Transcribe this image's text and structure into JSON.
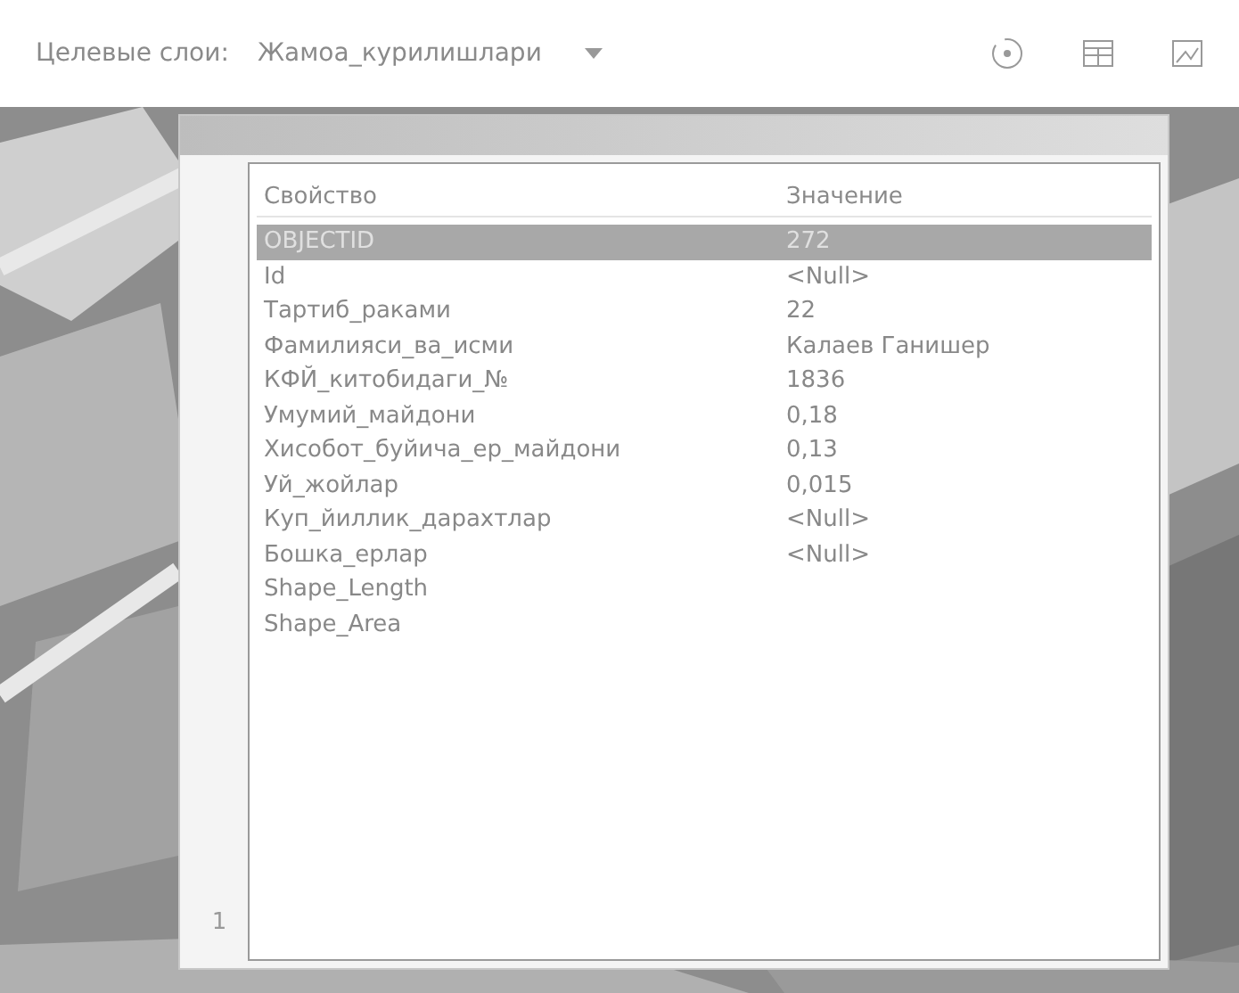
{
  "toolbar": {
    "label": "Целевые слои:",
    "layer": "Жамоа_курилишлари"
  },
  "attributes": {
    "columns": [
      "Свойство",
      "Значение"
    ],
    "rows": [
      {
        "property": "OBJECTID",
        "value": "272",
        "selected": true
      },
      {
        "property": "Id",
        "value": "<Null>",
        "selected": false
      },
      {
        "property": "Тартиб_раками",
        "value": "22",
        "selected": false
      },
      {
        "property": "Фамилияси_ва_исми",
        "value": "Калаев Ганишер",
        "selected": false
      },
      {
        "property": "КФЙ_китобидаги_№",
        "value": "1836",
        "selected": false
      },
      {
        "property": "Умумий_майдони",
        "value": "0,18",
        "selected": false
      },
      {
        "property": "Хисобот_буйича_ер_майдони",
        "value": "0,13",
        "selected": false
      },
      {
        "property": "Уй_жойлар",
        "value": "0,015",
        "selected": false
      },
      {
        "property": "Куп_йиллик_дарахтлар",
        "value": "<Null>",
        "selected": false
      },
      {
        "property": "Бошка_ерлар",
        "value": "<Null>",
        "selected": false
      },
      {
        "property": "Shape_Length",
        "selected": false
      },
      {
        "property": "Shape_Area",
        "selected": false
      }
    ],
    "record": "1"
  }
}
